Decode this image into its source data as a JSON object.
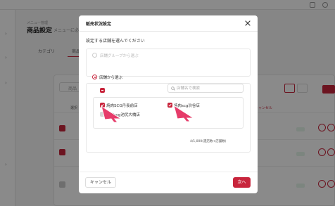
{
  "background": {
    "breadcrumb": "メニュー管理",
    "title": "商品設定",
    "subtitle": "メニューに必要",
    "tabs": [
      "カテゴリ",
      "商品"
    ],
    "search_placeholder": "商品",
    "red_text": "キャンセル",
    "header_text": "選択"
  },
  "modal": {
    "title": "販売状況設定",
    "instruction": "設定する店舗を選んでください",
    "option_group_label": "店舗グループから選ぶ",
    "option_store_label": "店舗から選ぶ",
    "store_search_placeholder": "店舗名で検索",
    "stores": [
      {
        "name": "焼肉SCG丹長前店",
        "checked": true
      },
      {
        "name": "焼肉scg渋谷店",
        "checked": true
      },
      {
        "name": "焼肉scg池尻大橋店",
        "checked": false
      }
    ],
    "selected_count_text": "4/1,000(選店数+店舗数)",
    "cancel_label": "キャンセル",
    "next_label": "次へ"
  },
  "colors": {
    "accent": "#c8253c",
    "overlay": "rgba(0,0,0,0.46)"
  }
}
